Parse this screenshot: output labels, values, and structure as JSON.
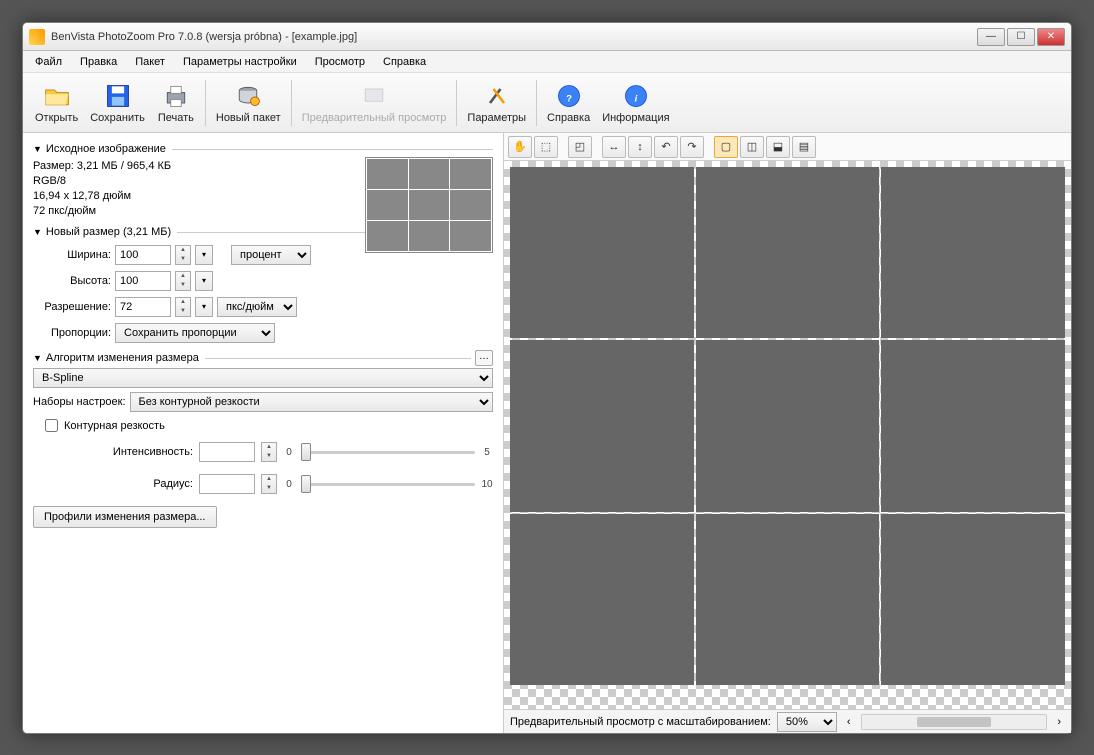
{
  "window": {
    "title": "BenVista PhotoZoom Pro 7.0.8 (wersja próbna) - [example.jpg]"
  },
  "menu": {
    "file": "Файл",
    "edit": "Правка",
    "batch": "Пакет",
    "settings": "Параметры настройки",
    "view": "Просмотр",
    "help": "Справка"
  },
  "toolbar": {
    "open": "Открыть",
    "save": "Сохранить",
    "print": "Печать",
    "newbatch": "Новый пакет",
    "preview": "Предварительный просмотр",
    "params": "Параметры",
    "helpbtn": "Справка",
    "info": "Информация"
  },
  "source": {
    "header": "Исходное изображение",
    "size": "Размер: 3,21 МБ / 965,4 КБ",
    "mode": "RGB/8",
    "dims": "16,94 x 12,78 дюйм",
    "dpi": "72 пкс/дюйм"
  },
  "newsize": {
    "header": "Новый размер (3,21 МБ)",
    "width_lbl": "Ширина:",
    "width_val": "100",
    "height_lbl": "Высота:",
    "height_val": "100",
    "unit1": "процент",
    "res_lbl": "Разрешение:",
    "res_val": "72",
    "unit2": "пкс/дюйм",
    "aspect_lbl": "Пропорции:",
    "aspect_val": "Сохранить пропорции"
  },
  "algo": {
    "header": "Алгоритм изменения размера",
    "method": "B-Spline",
    "presets_lbl": "Наборы настроек:",
    "presets_val": "Без контурной резкости",
    "unsharp_chk": "Контурная резкость",
    "intensity_lbl": "Интенсивность:",
    "intensity_val": "",
    "intensity_min": "0",
    "intensity_max": "5",
    "radius_lbl": "Радиус:",
    "radius_val": "",
    "radius_min": "0",
    "radius_max": "10",
    "profiles_btn": "Профили изменения размера..."
  },
  "preview": {
    "zoom_lbl": "Предварительный просмотр с масштабированием:",
    "zoom_val": "50%"
  }
}
